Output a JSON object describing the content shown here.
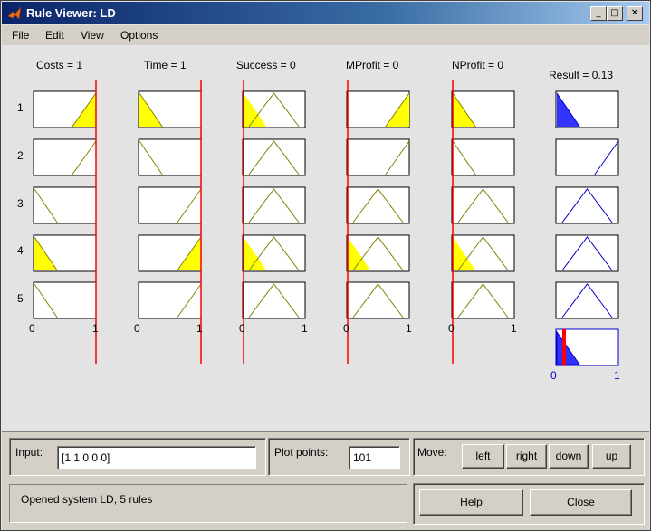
{
  "window": {
    "title": "Rule Viewer: LD",
    "controls": {
      "minimize": "_",
      "maximize": "□",
      "close": "✕"
    }
  },
  "menu": [
    "File",
    "Edit",
    "View",
    "Options"
  ],
  "inputs": [
    {
      "title": "Costs = 1",
      "value": 1,
      "range": [
        0,
        1
      ],
      "tick_left": "0",
      "tick_right": "1"
    },
    {
      "title": "Time = 1",
      "value": 1,
      "range": [
        0,
        1
      ],
      "tick_left": "0",
      "tick_right": "1"
    },
    {
      "title": "Success = 0",
      "value": 0,
      "range": [
        0,
        1
      ],
      "tick_left": "0",
      "tick_right": "1"
    },
    {
      "title": "MProfit = 0",
      "value": 0,
      "range": [
        0,
        1
      ],
      "tick_left": "0",
      "tick_right": "1"
    },
    {
      "title": "NProfit = 0",
      "value": 0,
      "range": [
        0,
        1
      ],
      "tick_left": "0",
      "tick_right": "1"
    }
  ],
  "output": {
    "title": "Result = 0.13",
    "value": 0.13,
    "range": [
      0,
      1
    ],
    "tick_left": "0",
    "tick_right": "1"
  },
  "rules": [
    "1",
    "2",
    "3",
    "4",
    "5"
  ],
  "membership": {
    "inputs": [
      [
        "rise",
        "fall",
        "tri",
        "rise",
        "fall"
      ],
      [
        "rise",
        "fall",
        "tri",
        "rise",
        "fall"
      ],
      [
        "fall",
        "rise",
        "tri",
        "tri",
        "tri"
      ],
      [
        "fall",
        "rise",
        "tri",
        "tri",
        "tri"
      ],
      [
        "fall",
        "rise",
        "tri",
        "tri",
        "tri"
      ]
    ],
    "output": [
      "fall",
      "rise",
      "tri",
      "tri",
      "tri"
    ],
    "firing": [
      1,
      0,
      0,
      1,
      0
    ]
  },
  "colors": {
    "input_line": "#808000",
    "input_fill": "#ffff00",
    "output_line": "#0000cc",
    "output_fill": "#3333ff",
    "cursor": "#ff0000"
  },
  "panel": {
    "input_label": "Input:",
    "input_value": "[1 1 0 0 0]",
    "plot_points_label": "Plot points:",
    "plot_points_value": "101",
    "move_label": "Move:",
    "move_buttons": [
      "left",
      "right",
      "down",
      "up"
    ],
    "status": "Opened system LD, 5 rules",
    "help": "Help",
    "close": "Close"
  }
}
